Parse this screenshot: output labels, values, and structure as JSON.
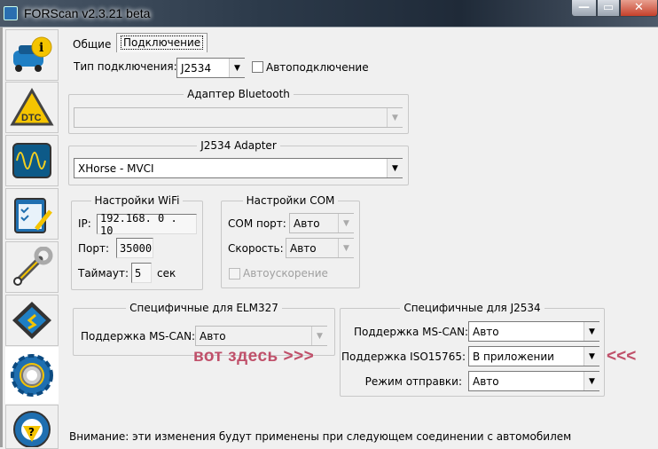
{
  "window": {
    "title": "FORScan v2.3.21 beta",
    "minimize": "—",
    "maximize": "▭",
    "close": "✕"
  },
  "sidebar": {
    "items": [
      {
        "name": "vehicle-info",
        "icon": "car-info-icon"
      },
      {
        "name": "dtc",
        "icon": "dtc-icon",
        "label": "DTC"
      },
      {
        "name": "oscilloscope",
        "icon": "oscilloscope-icon"
      },
      {
        "name": "tests",
        "icon": "checklist-icon"
      },
      {
        "name": "service",
        "icon": "wrench-icon"
      },
      {
        "name": "programming",
        "icon": "chip-icon"
      },
      {
        "name": "settings",
        "icon": "gear-icon",
        "selected": true
      },
      {
        "name": "help",
        "icon": "help-wheel-icon",
        "label": "?"
      }
    ]
  },
  "tabs": [
    {
      "label": "Общие"
    },
    {
      "label": "Подключение",
      "selected": true
    }
  ],
  "connection": {
    "type_label": "Тип подключения:",
    "type_value": "J2534",
    "autoconnect_label": "Автоподключение",
    "autoconnect_checked": false
  },
  "bluetooth": {
    "title": "Адаптер Bluetooth",
    "value": ""
  },
  "j2534_adapter": {
    "title": "J2534 Adapter",
    "value": "XHorse - MVCI"
  },
  "wifi": {
    "title": "Настройки WiFi",
    "ip_label": "IP:",
    "ip_value": "192.168. 0 . 10",
    "port_label": "Порт:",
    "port_value": "35000",
    "timeout_label": "Таймаут:",
    "timeout_value": "5",
    "timeout_unit": "сек"
  },
  "com": {
    "title": "Настройки COM",
    "port_label": "COM порт:",
    "port_value": "Авто",
    "speed_label": "Скорость:",
    "speed_value": "Авто",
    "autospeed_label": "Автоускорение"
  },
  "elm327": {
    "title": "Специфичные для ELM327",
    "mscan_label": "Поддержка MS-CAN:",
    "mscan_value": "Авто"
  },
  "j2534": {
    "title": "Специфичные для J2534",
    "mscan_label": "Поддержка MS-CAN:",
    "mscan_value": "Авто",
    "iso_label": "Поддержка ISO15765:",
    "iso_value": "В приложении",
    "send_label": "Режим отправки:",
    "send_value": "Авто"
  },
  "annotation": {
    "left": "вот здесь >>>",
    "right": "<<<",
    "color": "#c0506a"
  },
  "note": "Внимание: эти изменения будут применены при следующем соединении с автомобилем"
}
